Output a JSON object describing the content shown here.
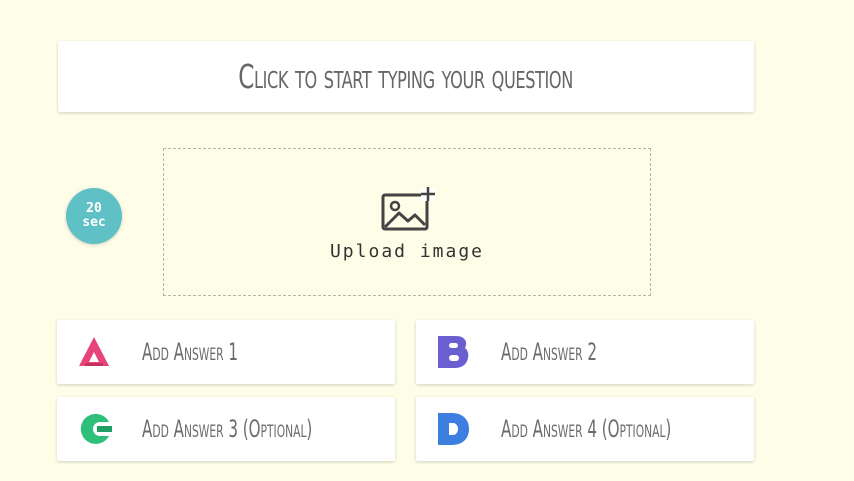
{
  "question": {
    "placeholder": "Click to start typing your question"
  },
  "timer": {
    "value": "20",
    "unit": "sec",
    "color": "#5fc1c6"
  },
  "upload": {
    "label": "Upload image",
    "icon": "image-add-icon"
  },
  "answers": [
    {
      "label": "Add Answer 1",
      "icon": "letter-a-triangle-icon",
      "color": "#e8447a"
    },
    {
      "label": "Add Answer 2",
      "icon": "letter-b-icon",
      "color": "#6a5fd1"
    },
    {
      "label": "Add Answer 3 (Optional)",
      "icon": "letter-c-icon",
      "color": "#2ebf7a"
    },
    {
      "label": "Add Answer 4 (Optional)",
      "icon": "letter-d-icon",
      "color": "#3d7fe0"
    }
  ],
  "colors": {
    "background": "#fdfde8",
    "card": "#ffffff"
  }
}
